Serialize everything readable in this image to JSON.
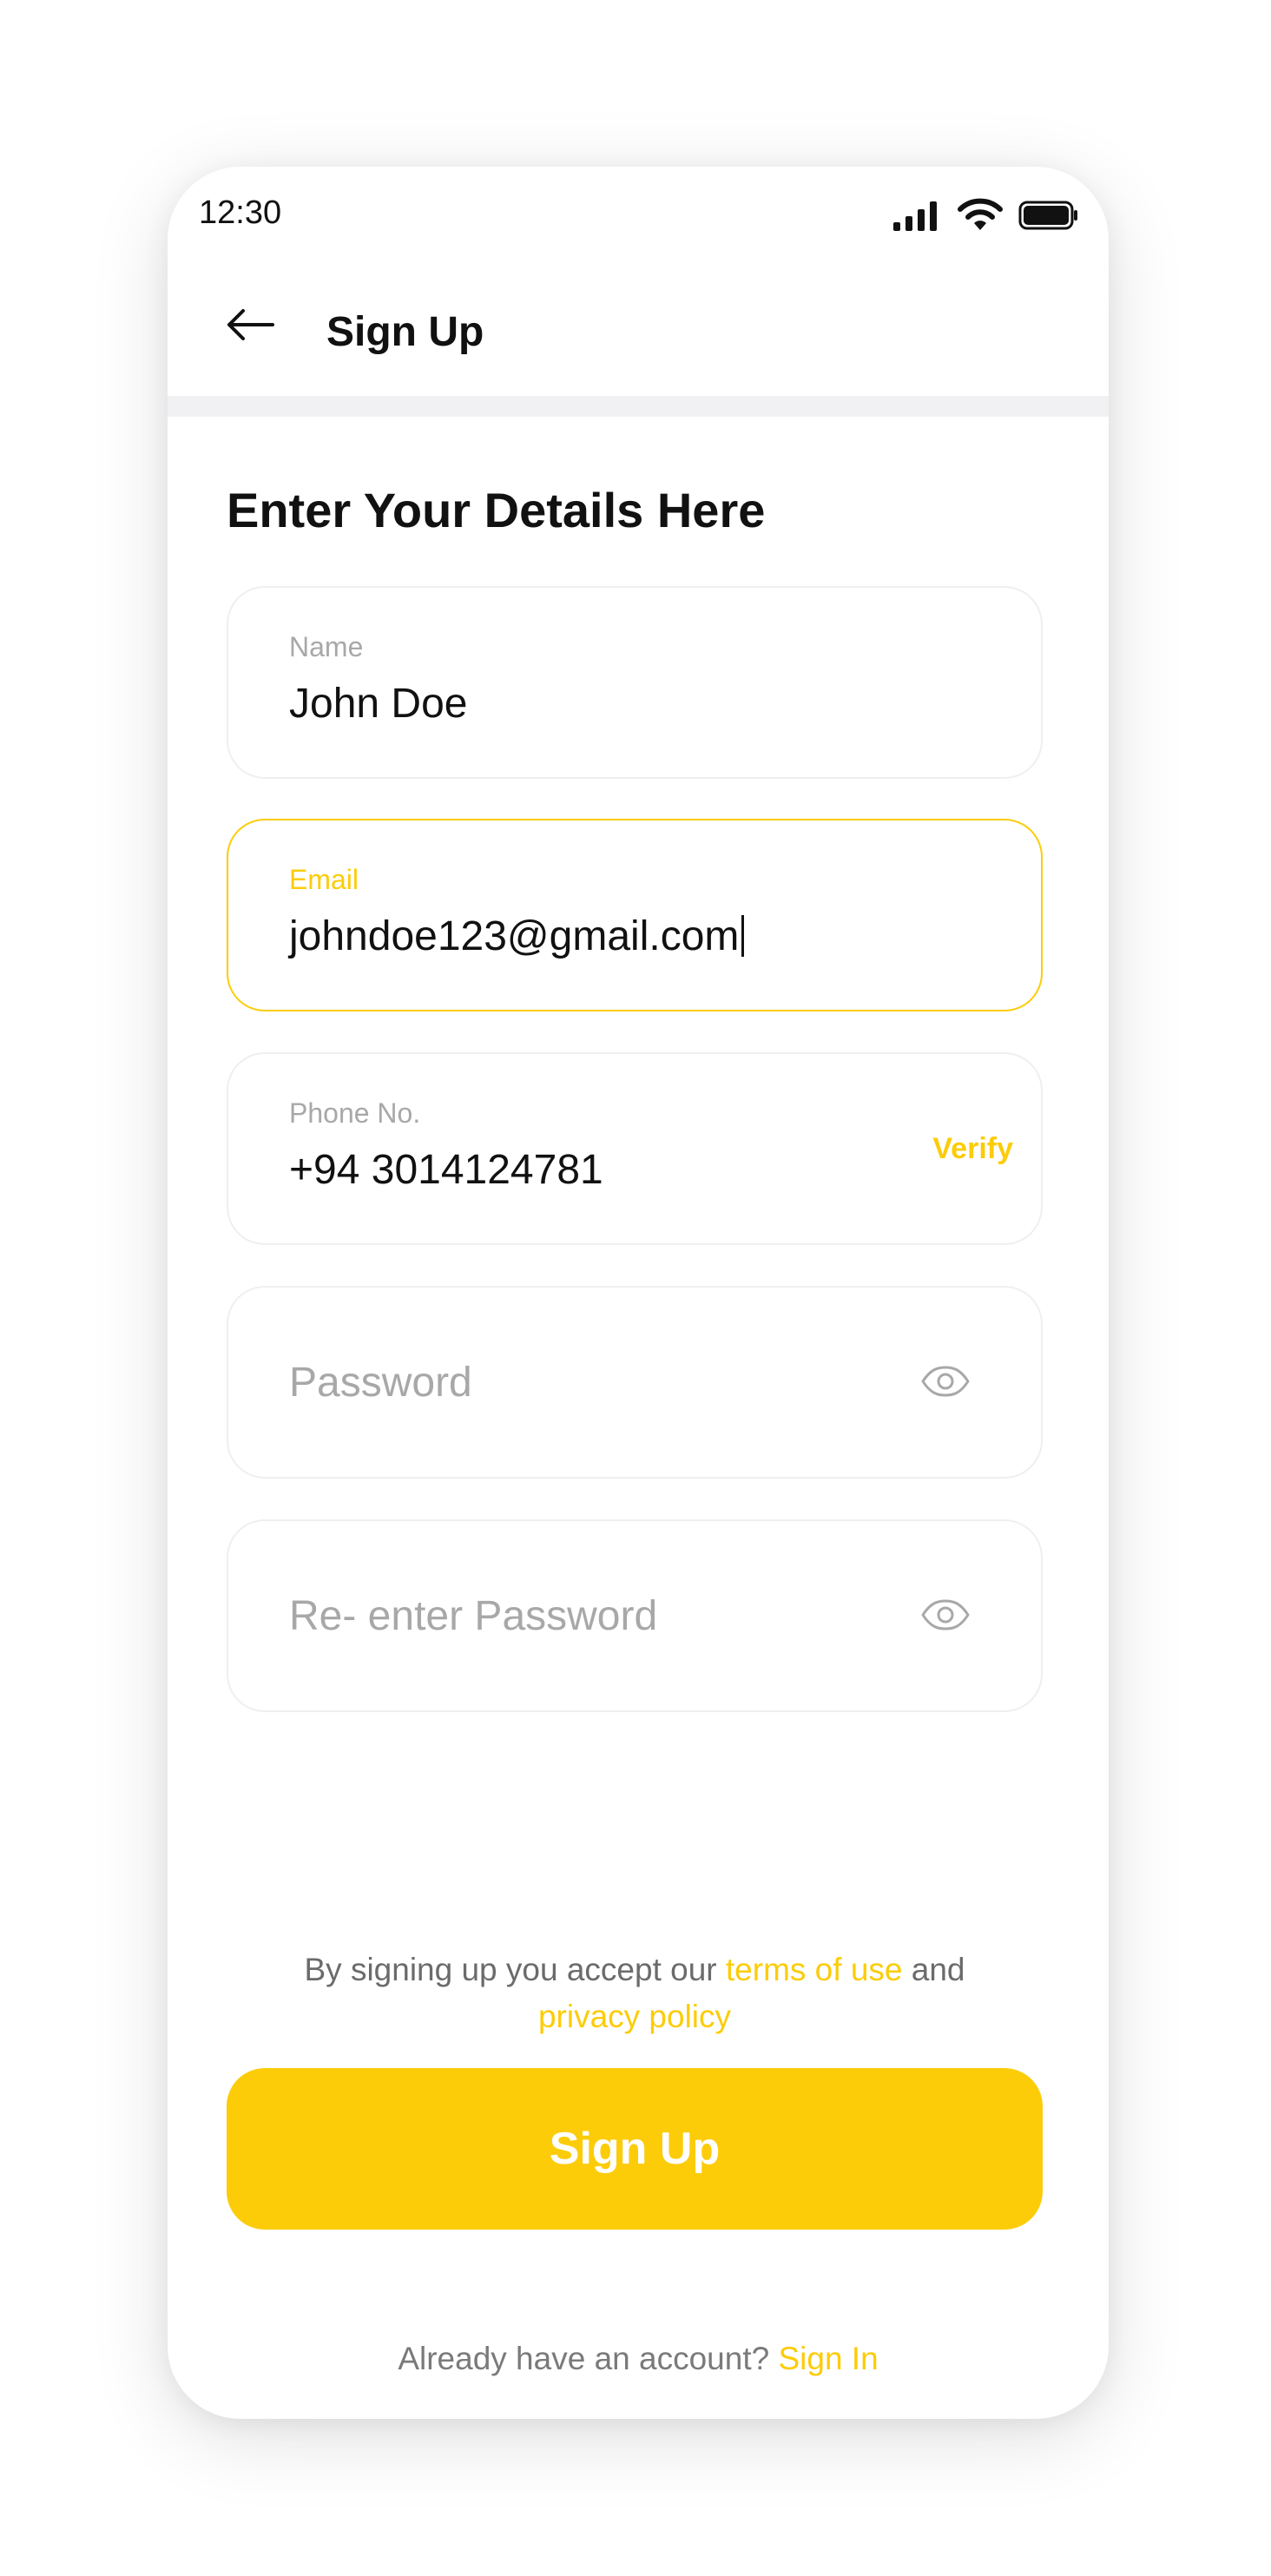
{
  "status_bar": {
    "time": "12:30",
    "icons": [
      "signal-icon",
      "wifi-icon",
      "battery-icon"
    ]
  },
  "header": {
    "back_icon": "arrow-left-icon",
    "title": "Sign Up"
  },
  "form": {
    "title": "Enter Your Details Here",
    "name": {
      "label": "Name",
      "value": "John Doe"
    },
    "email": {
      "label": "Email",
      "value": "johndoe123@gmail.com",
      "focused": true
    },
    "phone": {
      "label": "Phone No.",
      "value": "+94 3014124781",
      "action": "Verify"
    },
    "password": {
      "placeholder": "Password",
      "icon": "eye-icon"
    },
    "confirm_password": {
      "placeholder": "Re- enter Password",
      "icon": "eye-icon"
    }
  },
  "terms": {
    "prefix": "By signing up you accept our ",
    "terms_link": "terms of use",
    "middle": " and",
    "privacy_link": "privacy policy"
  },
  "submit": {
    "label": "Sign Up"
  },
  "signin": {
    "prompt": "Already have an account? ",
    "link": "Sign In"
  },
  "colors": {
    "accent": "#FCCC09",
    "text": "#111111",
    "muted": "#A8A8A8",
    "border": "#EFEFEF",
    "divider": "#F1F1F3"
  }
}
